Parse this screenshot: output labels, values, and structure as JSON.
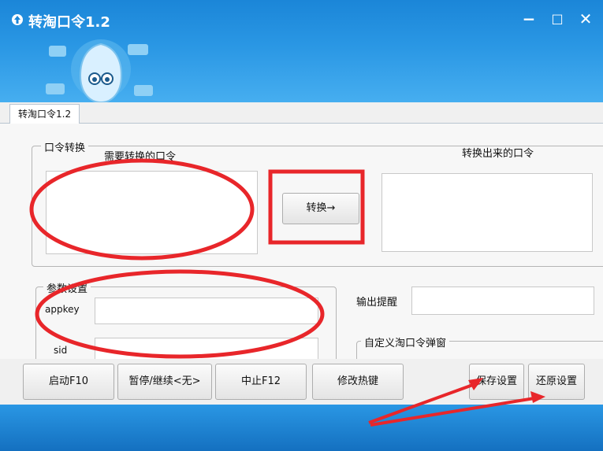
{
  "window": {
    "title": "转淘口令1.2",
    "controls": {
      "minimize": "−",
      "maximize": "□",
      "close": "✕"
    }
  },
  "tabs": [
    {
      "label": "转淘口令1.2"
    }
  ],
  "convert_group": {
    "title": "口令转换",
    "input_label": "需要转换的口令",
    "output_label": "转换出来的口令",
    "convert_button": "转换→"
  },
  "params_group": {
    "title": "参数设置",
    "appkey_label": "appkey",
    "sid_label": "sid"
  },
  "output_reminder_label": "输出提醒",
  "custom_popup_group": {
    "title": "自定义淘口令弹窗"
  },
  "toolbar": {
    "start": "启动F10",
    "pause": "暂停/继续<无>",
    "stop": "中止F12",
    "hotkey": "修改热键",
    "save": "保存设置",
    "restore": "还原设置"
  },
  "colors": {
    "title_bg": "#1b86d8",
    "annotation": "#e8262a"
  }
}
